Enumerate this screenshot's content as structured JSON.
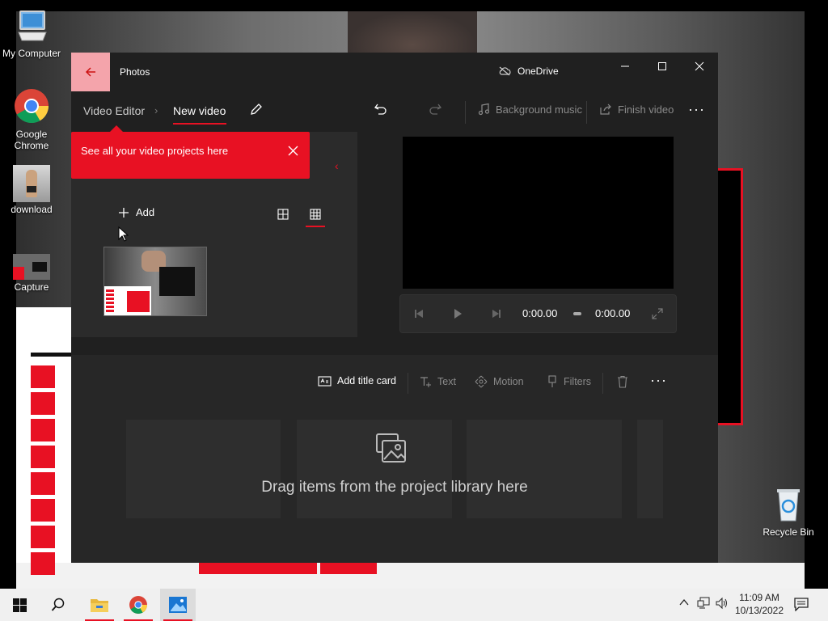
{
  "desktop": {
    "icons": [
      {
        "label": "My Computer",
        "icon": "computer-icon"
      },
      {
        "label": "Google Chrome",
        "icon": "chrome-icon"
      },
      {
        "label": "download",
        "icon": "image-file-icon"
      },
      {
        "label": "Capture",
        "icon": "image-file-icon"
      },
      {
        "label": "Recycle Bin",
        "icon": "recycle-bin-icon"
      }
    ]
  },
  "window": {
    "app_title": "Photos",
    "onedrive_label": "OneDrive",
    "breadcrumb": {
      "parent": "Video Editor",
      "current": "New video"
    },
    "toolbar": {
      "background_music": "Background music",
      "finish_video": "Finish video"
    },
    "tip": {
      "text": "See all your video projects here"
    },
    "library": {
      "add_label": "Add"
    },
    "player": {
      "current_time": "0:00.00",
      "total_time": "0:00.00"
    },
    "storyboard": {
      "add_title_card": "Add title card",
      "text": "Text",
      "motion": "Motion",
      "filters": "Filters",
      "drag_hint": "Drag items from the project library here"
    }
  },
  "taskbar": {
    "apps": [
      "start-icon",
      "search-icon",
      "file-explorer-icon",
      "chrome-icon",
      "photos-icon"
    ],
    "time": "11:09 AM",
    "date": "10/13/2022"
  },
  "colors": {
    "accent": "#e81123",
    "window_bg": "#202020",
    "panel_bg": "#2b2b2b"
  }
}
